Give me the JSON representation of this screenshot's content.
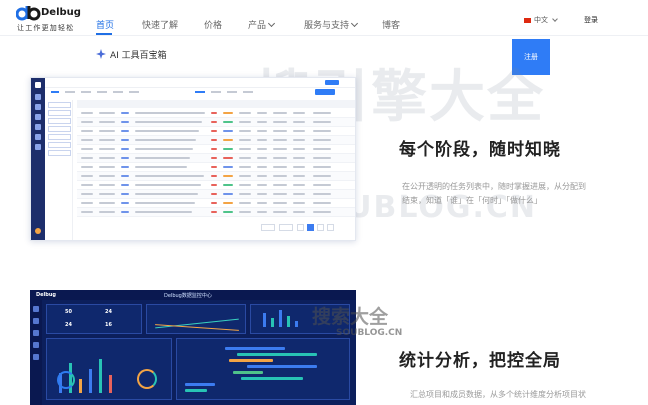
{
  "brand": {
    "name": "Delbug",
    "tagline": "让工作更加轻松",
    "color": "#1f6fe5"
  },
  "nav": {
    "items": [
      {
        "label": "首页",
        "active": true
      },
      {
        "label": "快速了解",
        "active": false
      },
      {
        "label": "价格",
        "active": false
      },
      {
        "label": "产品",
        "active": false,
        "dropdown": true
      },
      {
        "label": "服务与支持",
        "active": false,
        "dropdown": true
      },
      {
        "label": "博客",
        "active": false
      }
    ]
  },
  "header_right": {
    "language": "中文",
    "login": "登录",
    "register": "注册"
  },
  "ai_badge": "AI 工具百宝箱",
  "feature1": {
    "title": "每个阶段，随时知晓",
    "desc": "在公开透明的任务列表中，随时掌握进展，从分配到结束，知道「谁」在「何时」「做什么」"
  },
  "feature2": {
    "title": "统计分析，把控全局",
    "desc": "汇总项目和成员数据，从多个统计维度分析项目状"
  },
  "dashboard": {
    "logo": "Delbug",
    "title": "Delbug数据监控中心",
    "kpis": [
      "50",
      "24",
      "24",
      "16"
    ]
  },
  "watermarks": {
    "big": "搜引擎大全",
    "url": "SOUBLOG.CN",
    "small": "搜索大全",
    "small_url": "SOUBLOG.CN"
  },
  "colors": {
    "accent": "#2f7cf6",
    "dashboard_bg": "#0c1f5c",
    "sidebar": "#1d2e6b"
  }
}
